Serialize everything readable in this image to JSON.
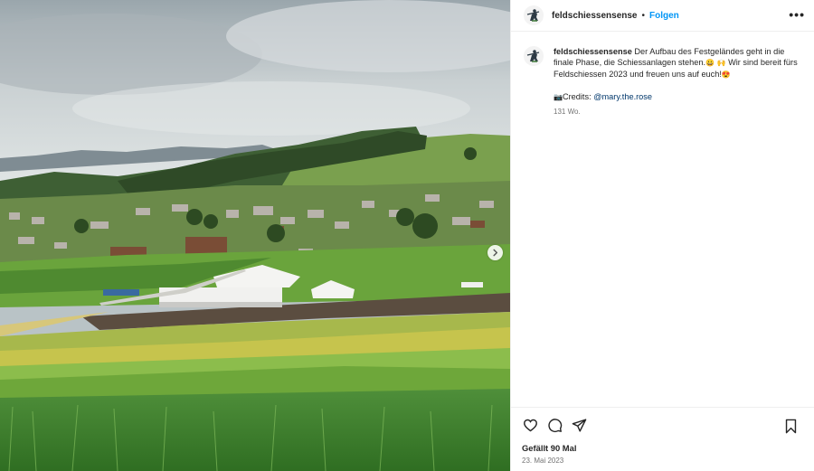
{
  "post": {
    "username": "feldschiessensense",
    "dot": "•",
    "follow_label": "Folgen",
    "more_label": "•••",
    "caption": {
      "username": "feldschiessensense",
      "text": " Der Aufbau des Festgeländes geht in die finale Phase, die Schiessanlagen stehen.",
      "text2": " Wir sind bereit fürs Feldschiessen 2023 und freuen uns auf euch!",
      "emoji_1": "😀",
      "emoji_2": "🙌",
      "emoji_3": "😍",
      "credits_emoji": "📷",
      "credits_label": "Credits: ",
      "mention": "@mary.the.rose",
      "age": "131 Wo."
    },
    "likes": "Gefällt 90 Mal",
    "date": "23. Mai 2023"
  },
  "icons": {
    "next": "chevron-right-icon",
    "like": "heart-icon",
    "comment": "comment-icon",
    "share": "paper-plane-icon",
    "save": "bookmark-icon"
  },
  "colors": {
    "link": "#0095f6",
    "mention": "#00376b",
    "text": "#262626",
    "muted": "#737373"
  }
}
